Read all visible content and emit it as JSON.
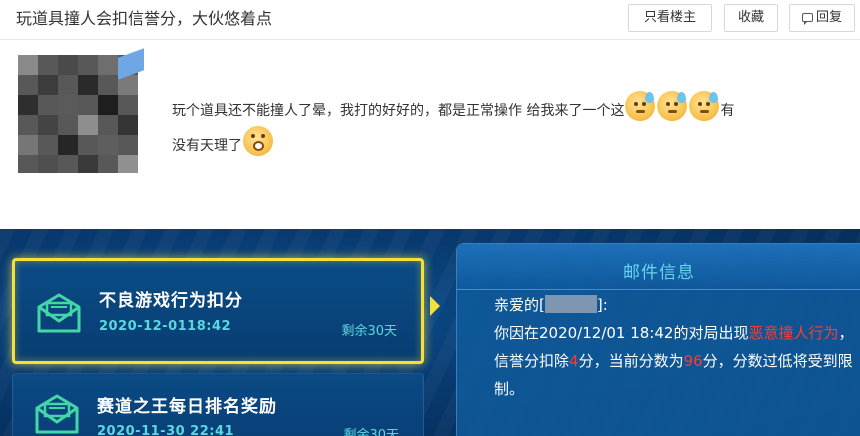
{
  "thread": {
    "title": "玩道具撞人会扣信誉分，大伙悠着点",
    "only_op_label": "只看楼主",
    "collect_label": "收藏",
    "reply_label": "回复"
  },
  "post": {
    "text_part1": "玩个道具还不能撞人了晕，我打的好好的，都是正常操作 给我来了一个这",
    "text_part2": "有",
    "text_part3": "没有天理了",
    "emojis": [
      "sweat-emoji",
      "sweat-emoji",
      "sweat-emoji",
      "scream-emoji"
    ]
  },
  "game_mail": {
    "items": [
      {
        "title": "不良游戏行为扣分",
        "date": "2020-12-0118:42",
        "remaining": "剩余30天",
        "selected": true
      },
      {
        "title": "赛道之王每日排名奖励",
        "date": "2020-11-30 22:41",
        "remaining": "剩余30天",
        "selected": false
      }
    ],
    "detail": {
      "header": "邮件信息",
      "greeting_prefix": "亲爱的[",
      "greeting_suffix": "]:",
      "line_prefix": "你因在2020/12/01 18:42的对局出现",
      "violation": "恶意撞人行为",
      "mid1": "，信誉分扣除",
      "deducted": "4",
      "mid2": "分，当前分数为",
      "current": "96",
      "tail": "分，分数过低将受到限制。"
    },
    "colors": {
      "highlight": "#ff3b30",
      "selected_border": "#f3e03a",
      "date_color": "#5ad8e0",
      "header_color": "#67d4ee"
    }
  }
}
